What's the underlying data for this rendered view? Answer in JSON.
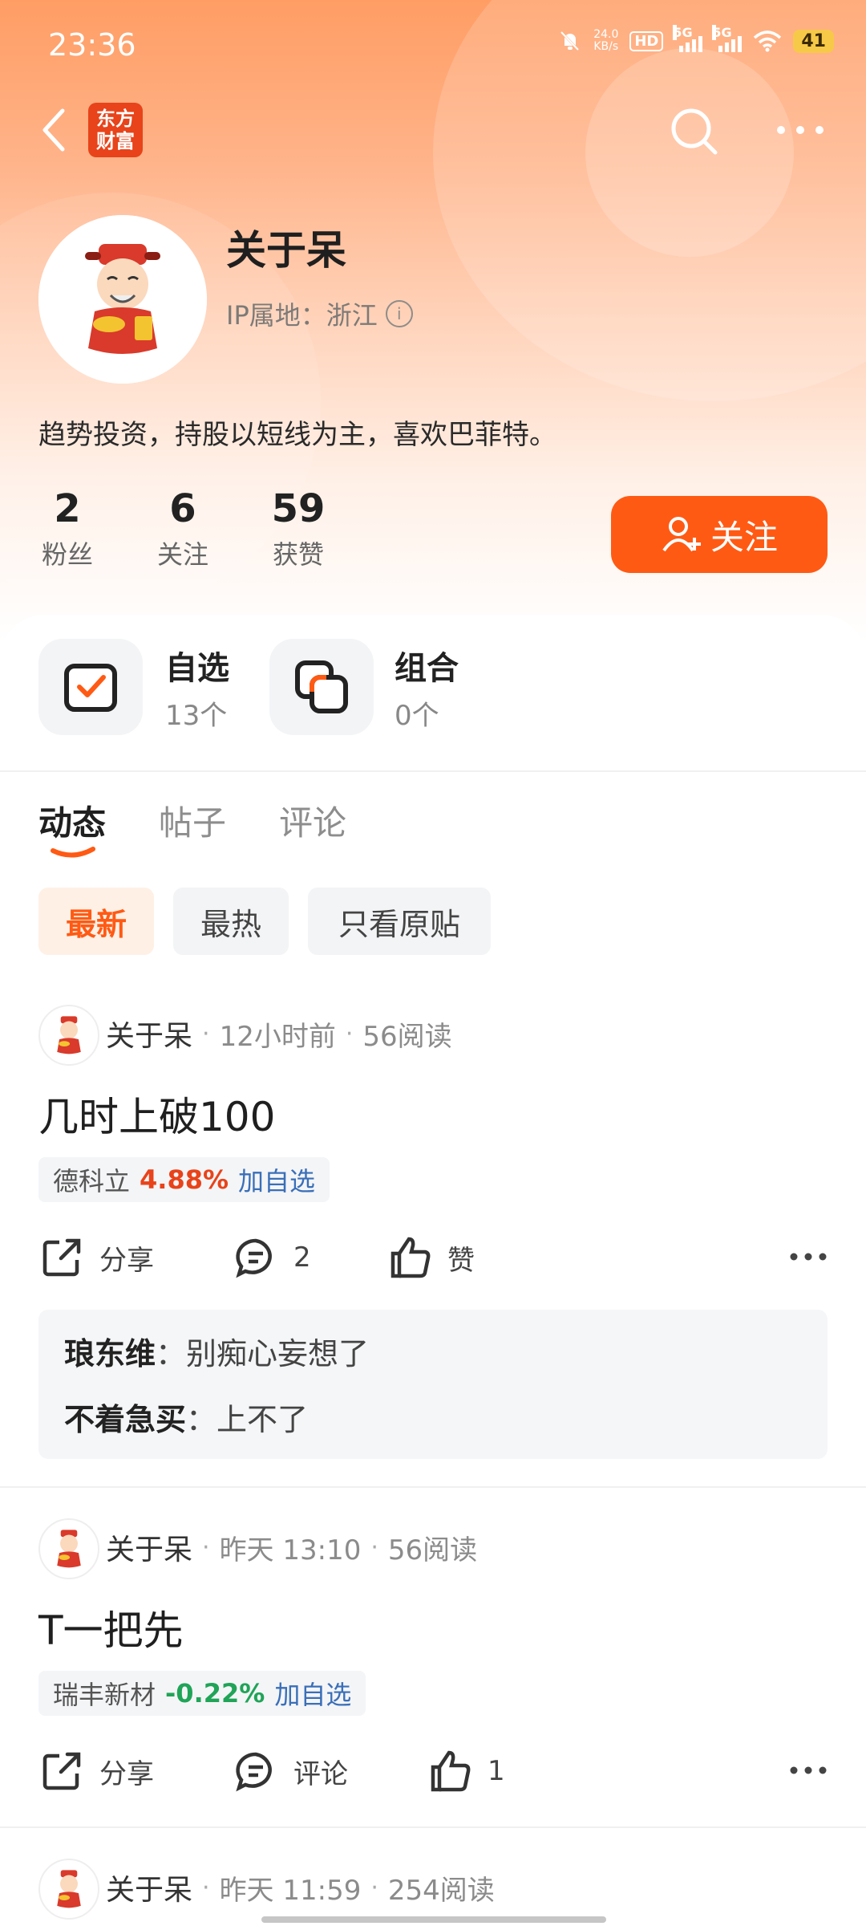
{
  "status_bar": {
    "time": "23:36",
    "net_speed_value": "24.0",
    "net_speed_unit": "KB/s",
    "hd": "HD",
    "sig1": "5G",
    "sig2": "5G",
    "battery": "41"
  },
  "header": {
    "logo_line1": "东方",
    "logo_line2": "财富"
  },
  "profile": {
    "name": "关于呆",
    "ip_label": "IP属地：浙江",
    "bio": "趋势投资，持股以短线为主，喜欢巴菲特。",
    "stats": [
      {
        "value": "2",
        "label": "粉丝"
      },
      {
        "value": "6",
        "label": "关注"
      },
      {
        "value": "59",
        "label": "获赞"
      }
    ],
    "follow_label": "关注"
  },
  "quick": [
    {
      "title": "自选",
      "sub": "13个",
      "icon": "watchlist-check-icon"
    },
    {
      "title": "组合",
      "sub": "0个",
      "icon": "portfolio-icon"
    }
  ],
  "tabs": [
    {
      "label": "动态",
      "active": true
    },
    {
      "label": "帖子",
      "active": false
    },
    {
      "label": "评论",
      "active": false
    }
  ],
  "filters": [
    {
      "label": "最新",
      "active": true
    },
    {
      "label": "最热",
      "active": false
    },
    {
      "label": "只看原贴",
      "active": false
    }
  ],
  "posts": [
    {
      "author": "关于呆",
      "time": "12小时前",
      "reads": "56阅读",
      "title": "几时上破100",
      "stock": {
        "name": "德科立",
        "change": "4.88%",
        "add": "加自选",
        "color": "#e8431a"
      },
      "actions": {
        "share": "分享",
        "comment": "2",
        "like": "赞"
      },
      "comments": [
        {
          "user": "琅东维",
          "sep": "：",
          "text": "别痴心妄想了"
        },
        {
          "user": "不着急买",
          "sep": "：",
          "text": "上不了"
        }
      ]
    },
    {
      "author": "关于呆",
      "time": "昨天 13:10",
      "reads": "56阅读",
      "title": "T一把先",
      "stock": {
        "name": "瑞丰新材",
        "change": "-0.22%",
        "add": "加自选",
        "color": "#20a458"
      },
      "actions": {
        "share": "分享",
        "comment": "评论",
        "like": "1"
      }
    },
    {
      "author": "关于呆",
      "time": "昨天 11:59",
      "reads": "254阅读"
    }
  ],
  "colors": {
    "accent": "#ff5a14",
    "stock_up": "#e8431a",
    "stock_down": "#20a458",
    "link": "#3a6fb8"
  }
}
